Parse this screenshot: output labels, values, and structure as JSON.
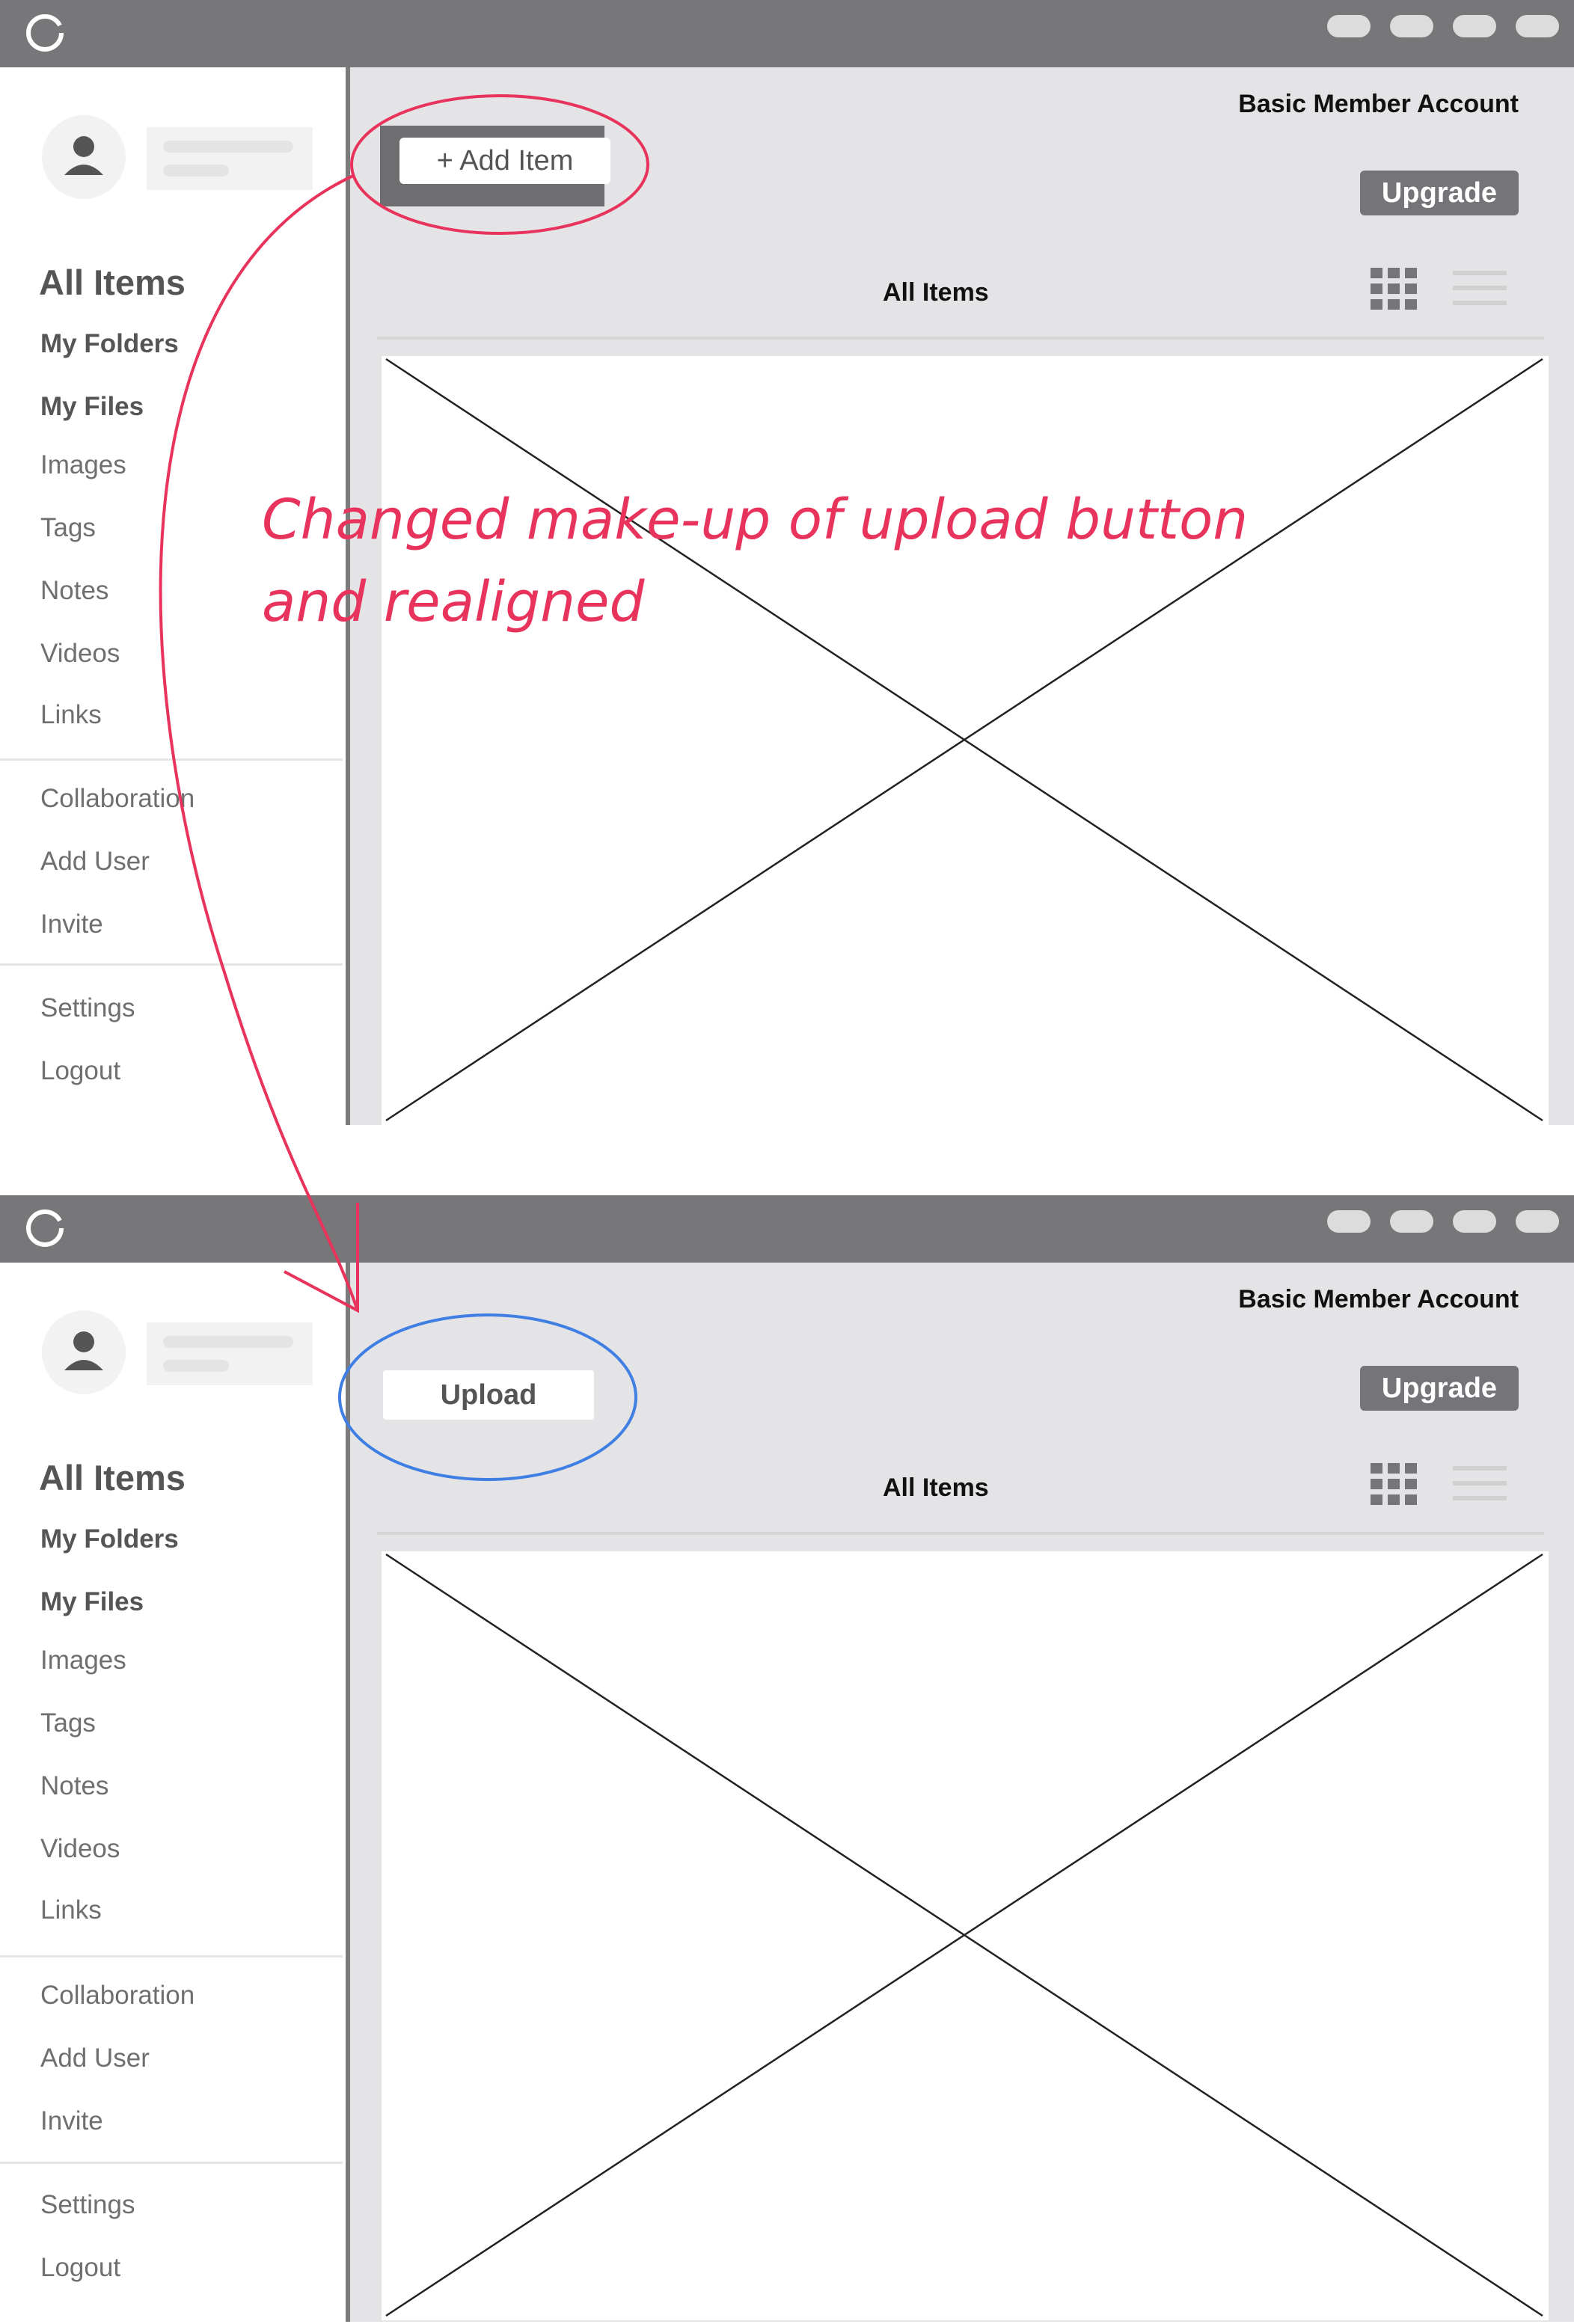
{
  "screen_before": {
    "account_label": "Basic Member Account",
    "upgrade_label": "Upgrade",
    "add_button_label": "+ Add Item",
    "section_title": "All Items",
    "sidebar": {
      "title": "All Items",
      "items": [
        {
          "label": "My Folders"
        },
        {
          "label": "My Files"
        },
        {
          "label": "Images"
        },
        {
          "label": "Tags"
        },
        {
          "label": "Notes"
        },
        {
          "label": "Videos"
        },
        {
          "label": "Links"
        },
        {
          "label": "Collaboration"
        },
        {
          "label": "Add User"
        },
        {
          "label": "Invite"
        },
        {
          "label": "Settings"
        },
        {
          "label": "Logout"
        }
      ]
    }
  },
  "screen_after": {
    "account_label": "Basic Member Account",
    "upgrade_label": "Upgrade",
    "upload_button_label": "Upload",
    "section_title": "All Items",
    "sidebar": {
      "title": "All Items",
      "items": [
        {
          "label": "My Folders"
        },
        {
          "label": "My Files"
        },
        {
          "label": "Images"
        },
        {
          "label": "Tags"
        },
        {
          "label": "Notes"
        },
        {
          "label": "Videos"
        },
        {
          "label": "Links"
        },
        {
          "label": "Collaboration"
        },
        {
          "label": "Add User"
        },
        {
          "label": "Invite"
        },
        {
          "label": "Settings"
        },
        {
          "label": "Logout"
        }
      ]
    }
  },
  "annotation": {
    "line1": "Changed make-up of upload button",
    "line2": "and realigned"
  },
  "colors": {
    "titlebar": "#777679",
    "annotation_red": "#e8345c",
    "annotation_blue": "#3f7fe3",
    "panel_bg": "#e4e4e6",
    "upgrade_bg": "#757478"
  }
}
